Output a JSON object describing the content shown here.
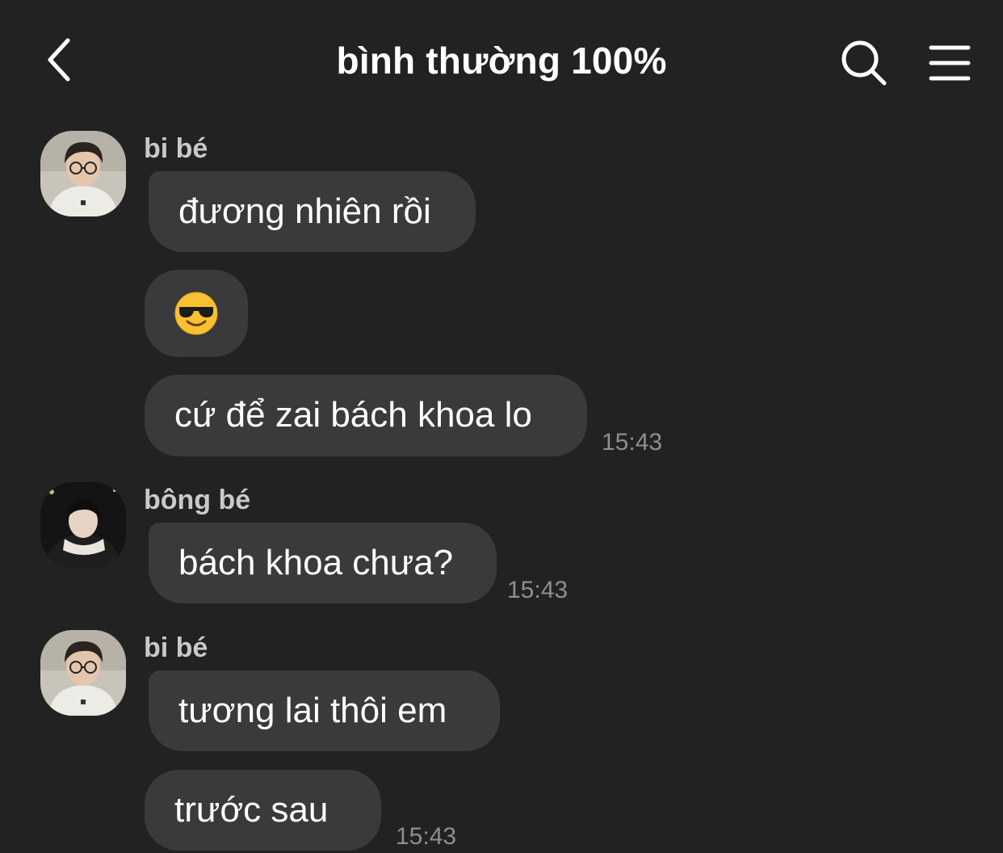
{
  "header": {
    "title": "bình thường 100%",
    "back_icon": "chevron-left-icon",
    "search_icon": "search-icon",
    "menu_icon": "menu-icon"
  },
  "messages": [
    {
      "sender": "bi bé",
      "avatar_icon": "avatar-photo",
      "bubbles": [
        {
          "text": "đương nhiên rồi"
        },
        {
          "emoji": "smiling-face-with-sunglasses"
        },
        {
          "text": "cứ để zai bách khoa lo"
        }
      ],
      "time": "15:43"
    },
    {
      "sender": "bông bé",
      "avatar_icon": "avatar-photo",
      "bubbles": [
        {
          "text": "bách khoa chưa?"
        }
      ],
      "time": "15:43"
    },
    {
      "sender": "bi bé",
      "avatar_icon": "avatar-photo",
      "bubbles": [
        {
          "text": "tương lai thôi em"
        },
        {
          "text": "trước sau"
        }
      ],
      "time": "15:43"
    }
  ],
  "colors": {
    "background": "#222223",
    "bubble": "#3a3a3c",
    "text": "#ffffff",
    "sender": "#c9c9cb",
    "timestamp": "#8e8e93"
  }
}
